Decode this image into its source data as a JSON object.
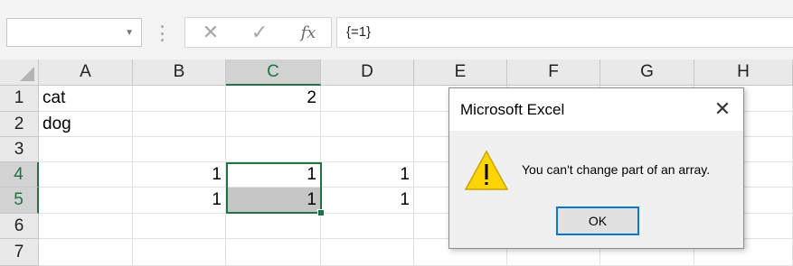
{
  "formula_bar": {
    "name_box_value": "",
    "cancel_icon": "close-icon",
    "enter_icon": "check-icon",
    "fx_label": "fx",
    "formula_value": "{=1}"
  },
  "grid": {
    "columns": [
      "A",
      "B",
      "C",
      "D",
      "E",
      "F",
      "G",
      "H"
    ],
    "rows": [
      "1",
      "2",
      "3",
      "4",
      "5",
      "6",
      "7"
    ],
    "cells": {
      "A1": "cat",
      "C1": "2",
      "A2": "dog",
      "B4": "1",
      "C4": "1",
      "D4": "1",
      "B5": "1",
      "C5": "1",
      "D5": "1"
    },
    "selected_column": "C",
    "selected_rows": [
      "4",
      "5"
    ],
    "selection_color": "#217346"
  },
  "dialog": {
    "title": "Microsoft Excel",
    "message": "You can't change part of an array.",
    "ok_label": "OK",
    "icon": "warning-icon",
    "accent": "#0078d7"
  }
}
